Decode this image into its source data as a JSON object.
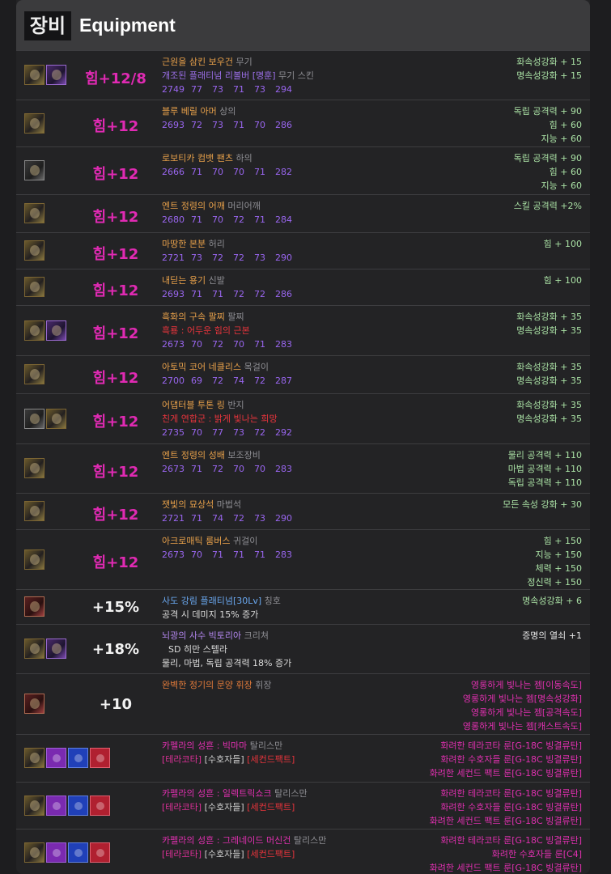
{
  "header": {
    "korean": "장비",
    "english": "Equipment"
  },
  "items": [
    {
      "icons": [
        "g",
        "p"
      ],
      "stat": "힘+12/8",
      "name": "근원을 삼킨 보우건",
      "slot": "무기",
      "line2": "개조된 플래티넘 리볼버 [명훈]",
      "line2_slot": "무기 스킨",
      "line2_color": "r2",
      "nums": [
        "2749",
        "77",
        "73",
        "71",
        "73",
        "294"
      ],
      "right": [
        "화속성강화 + 15",
        "명속성강화 + 15"
      ]
    },
    {
      "icons": [
        "g"
      ],
      "stat": "힘+12",
      "name": "블루 베릴 아머",
      "slot": "상의",
      "nums": [
        "2693",
        "72",
        "73",
        "71",
        "70",
        "286"
      ],
      "right": [
        "독립 공격력 + 90",
        "힘 + 60",
        "지능 + 60"
      ]
    },
    {
      "icons": [
        "s"
      ],
      "stat": "힘+12",
      "name": "로보티카 컴뱃 팬츠",
      "slot": "하의",
      "nums": [
        "2666",
        "71",
        "70",
        "70",
        "71",
        "282"
      ],
      "right": [
        "독립 공격력 + 90",
        "힘 + 60",
        "지능 + 60"
      ]
    },
    {
      "icons": [
        "g"
      ],
      "stat": "힘+12",
      "name": "엔트 정령의 어깨",
      "slot": "머리어깨",
      "nums": [
        "2680",
        "71",
        "70",
        "72",
        "71",
        "284"
      ],
      "right": [
        "스킬 공격력 +2%"
      ]
    },
    {
      "icons": [
        "g"
      ],
      "stat": "힘+12",
      "name": "마땅한 본분",
      "slot": "허리",
      "nums": [
        "2721",
        "73",
        "72",
        "72",
        "73",
        "290"
      ],
      "right": [
        "힘 + 100"
      ]
    },
    {
      "icons": [
        "g"
      ],
      "stat": "힘+12",
      "name": "내딛는 용기",
      "slot": "신발",
      "nums": [
        "2693",
        "71",
        "71",
        "72",
        "72",
        "286"
      ],
      "right": [
        "힘 + 100"
      ]
    },
    {
      "icons": [
        "g",
        "p"
      ],
      "stat": "힘+12",
      "name": "흑화의 구속 팔찌",
      "slot": "팔찌",
      "line2": "흑룡 : 어두운 힘의 근본",
      "line2_slot": "",
      "line2_color": "red",
      "nums": [
        "2673",
        "70",
        "72",
        "70",
        "71",
        "283"
      ],
      "right": [
        "화속성강화 + 35",
        "명속성강화 + 35"
      ]
    },
    {
      "icons": [
        "g"
      ],
      "stat": "힘+12",
      "name": "아토믹 코어 네클리스",
      "slot": "목걸이",
      "nums": [
        "2700",
        "69",
        "72",
        "74",
        "72",
        "287"
      ],
      "right": [
        "화속성강화 + 35",
        "명속성강화 + 35"
      ]
    },
    {
      "icons": [
        "s",
        "g"
      ],
      "stat": "힘+12",
      "name": "어댑터블 투톤 링",
      "slot": "반지",
      "line2": "친게 연합군 : 밝게 빛나는 희망",
      "line2_slot": "",
      "line2_color": "red",
      "nums": [
        "2735",
        "70",
        "77",
        "73",
        "72",
        "292"
      ],
      "right": [
        "화속성강화 + 35",
        "명속성강화 + 35"
      ]
    },
    {
      "icons": [
        "g"
      ],
      "stat": "힘+12",
      "name": "엔트 정령의 성배",
      "slot": "보조장비",
      "nums": [
        "2673",
        "71",
        "72",
        "70",
        "70",
        "283"
      ],
      "right": [
        "물리 공격력 + 110",
        "마법 공격력 + 110",
        "독립 공격력 + 110"
      ]
    },
    {
      "icons": [
        "g"
      ],
      "stat": "힘+12",
      "name": "잿빛의 묘상석",
      "slot": "마법석",
      "nums": [
        "2721",
        "71",
        "74",
        "72",
        "73",
        "290"
      ],
      "right": [
        "모든 속성 강화 + 30"
      ]
    },
    {
      "icons": [
        "g"
      ],
      "stat": "힘+12",
      "name": "아크로매틱 룸버스",
      "slot": "귀걸이",
      "nums": [
        "2673",
        "70",
        "71",
        "71",
        "71",
        "283"
      ],
      "right": [
        "힘 + 150",
        "지능 + 150",
        "체력 + 150",
        "정신력 + 150"
      ]
    }
  ],
  "title": {
    "icons": [
      "r"
    ],
    "stat": "+15%",
    "name": "사도 강림 플래티넘[30Lv]",
    "slot": "칭호",
    "desc": "공격 시 데미지 15% 증가",
    "right": [
      "명속성강화 + 6"
    ]
  },
  "creature": {
    "icons": [
      "g",
      "p"
    ],
    "stat": "+18%",
    "name": "뇌광의 사수 빅토리아",
    "slot": "크리쳐",
    "desc1": "SD 히만 스텔라",
    "desc2": "물리, 마법, 독립 공격력 18% 증가",
    "right": [
      "증명의 열쇠 +1"
    ]
  },
  "flag": {
    "icons": [
      "r"
    ],
    "stat": "+10",
    "name": "완벽한 정기의 문양 휘장",
    "slot": "휘장",
    "right": [
      "영롱하게 빛나는 젬[이동속도]",
      "영롱하게 빛나는 젬[명속성강화]",
      "영롱하게 빛나는 젬[공격속도]",
      "영롱하게 빛나는 젬[캐스트속도]"
    ]
  },
  "artifacts": [
    {
      "name": "카펠라의 성흔 : 빅마마",
      "slot": "탈리스만",
      "runes": [
        "[테라코타]",
        "[수호자들]",
        "[세컨드팩트]"
      ],
      "right": [
        "화려한 테라코타 룬[G-18C 빙결류탄]",
        "화려한 수호자들 룬[G-18C 빙결류탄]",
        "화려한 세컨드 팩트 룬[G-18C 빙결류탄]"
      ]
    },
    {
      "name": "카펠라의 성흔 : 일렉트릭쇼크",
      "slot": "탈리스만",
      "runes": [
        "[테라코타]",
        "[수호자들]",
        "[세컨드팩트]"
      ],
      "right": [
        "화려한 테라코타 룬[G-18C 빙결류탄]",
        "화려한 수호자들 룬[G-18C 빙결류탄]",
        "화려한 세컨드 팩트 룬[G-18C 빙결류탄]"
      ]
    },
    {
      "name": "카펠라의 성흔 : 그레네이드 머신건",
      "slot": "탈리스만",
      "runes": [
        "[테라코타]",
        "[수호자들]",
        "[세컨드팩트]"
      ],
      "right": [
        "화려한 테라코타 룬[G-18C 빙결류탄]",
        "화려한 수호자들 룬[C4]",
        "화려한 세컨드 팩트 룬[G-18C 빙결류탄]"
      ]
    }
  ]
}
